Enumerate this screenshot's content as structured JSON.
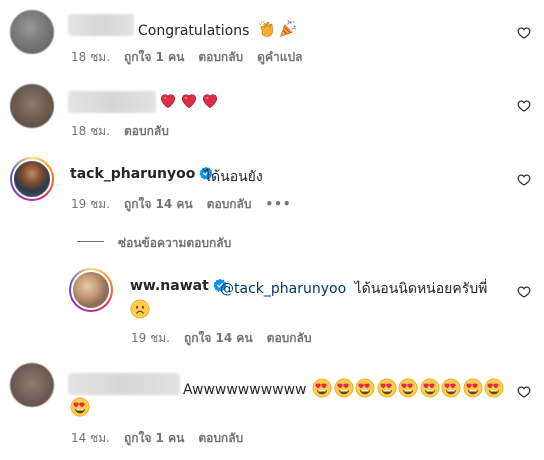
{
  "comments": [
    {
      "text": "Congratulations",
      "time": "18 ชม.",
      "likes": "ถูกใจ 1 คน",
      "reply": "ตอบกลับ",
      "translate": "ดูคำแปล"
    },
    {
      "time": "18 ชม.",
      "reply": "ตอบกลับ"
    },
    {
      "username": "tack_pharunyoo",
      "text": "ได้นอนยัง",
      "time": "19 ชม.",
      "likes": "ถูกใจ 14 คน",
      "reply": "ตอบกลับ",
      "more": "•••"
    },
    {
      "username": "ww.nawat",
      "mention": "@tack_pharunyoo",
      "text": "ได้นอนนิดหน่อยครับพี่",
      "time": "19 ชม.",
      "likes": "ถูกใจ 14 คน",
      "reply": "ตอบกลับ"
    },
    {
      "text": "Awwwwwwwwww",
      "time": "14 ชม.",
      "likes": "ถูกใจ 1 คน",
      "reply": "ตอบกลับ"
    }
  ],
  "hide_replies": "ซ่อนข้อความตอบกลับ",
  "icons": {
    "like": "heart-outline-icon",
    "verified": "verified-badge-icon",
    "clap": "clapping-hands-emoji",
    "party": "party-popper-emoji",
    "heart": "red-heart-emoji",
    "smile": "slightly-frowning-face-emoji",
    "heart_eyes": "heart-eyes-emoji"
  },
  "colors": {
    "text": "#262626",
    "secondary": "#737373",
    "mention": "#00376b",
    "verified": "#0095f6"
  }
}
